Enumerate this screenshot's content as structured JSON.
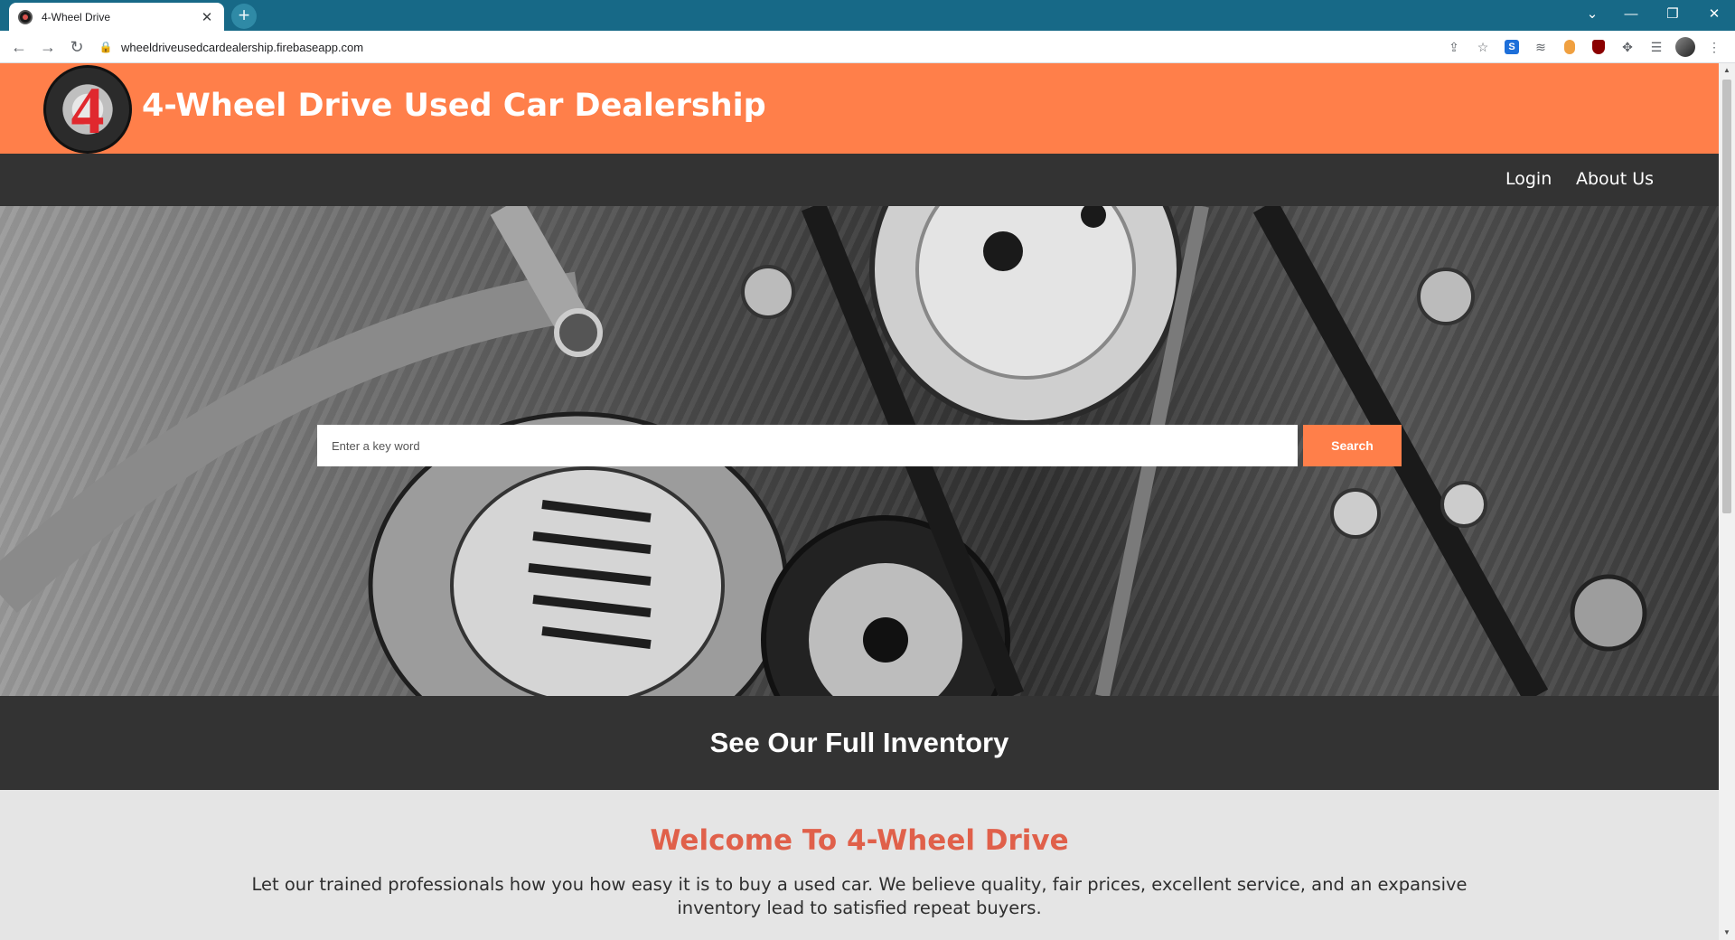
{
  "browser": {
    "tab_title": "4-Wheel Drive",
    "tab_close": "✕",
    "new_tab": "+",
    "url": "wheeldriveusedcardealership.firebaseapp.com",
    "controls": {
      "tab_search": "⌄",
      "minimize": "—",
      "restore": "❐",
      "close": "✕"
    },
    "nav": {
      "back": "←",
      "forward": "→",
      "reload": "↻",
      "lock": "🔒"
    },
    "toolbar_icons": [
      "share-icon",
      "star-icon",
      "skype-extension-icon",
      "drive-extension-icon",
      "honey-extension-icon",
      "ublock-extension-icon",
      "extensions-puzzle-icon",
      "reading-list-icon",
      "profile-avatar",
      "menu-icon"
    ]
  },
  "site": {
    "logo_text": "4",
    "title": "4-Wheel Drive Used Car Dealership",
    "nav": {
      "login": "Login",
      "about": "About Us"
    },
    "search": {
      "placeholder": "Enter a key word",
      "button": "Search"
    },
    "inventory_link": "See Our Full Inventory",
    "welcome": {
      "title": "Welcome To 4-Wheel Drive",
      "text": "Let our trained professionals how you how easy it is to buy a used car. We believe quality, fair prices, excellent service, and an expansive inventory lead to satisfied repeat buyers."
    }
  },
  "colors": {
    "accent": "#ff7f4a",
    "dark_band": "#333333",
    "welcome_title": "#e0604a",
    "browser_frame": "#176987"
  }
}
